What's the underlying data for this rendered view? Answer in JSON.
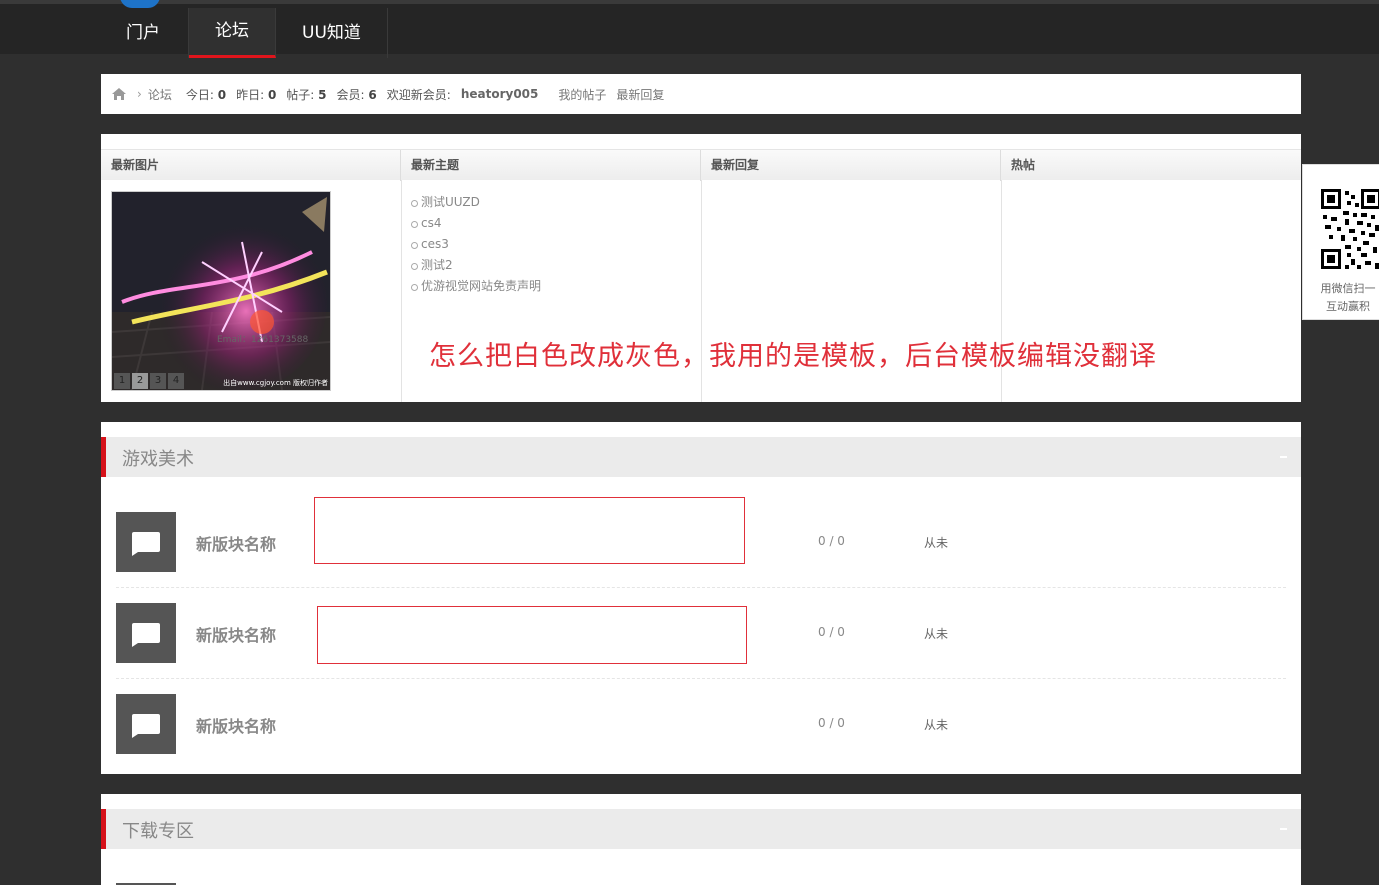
{
  "nav": {
    "items": [
      {
        "label": "门户",
        "active": false
      },
      {
        "label": "论坛",
        "active": true
      },
      {
        "label": "UU知道",
        "active": false
      }
    ]
  },
  "breadcrumb": {
    "home_icon": "home-icon",
    "separator": "›",
    "current": "论坛",
    "today_label": "今日:",
    "today_value": "0",
    "yesterday_label": "昨日:",
    "yesterday_value": "0",
    "posts_label": "帖子:",
    "posts_value": "5",
    "members_label": "会员:",
    "members_value": "6",
    "welcome_label": "欢迎新会员:",
    "welcome_user": "heatory005",
    "my_posts": "我的帖子",
    "latest_replies": "最新回复"
  },
  "portal": {
    "columns": [
      "最新图片",
      "最新主题",
      "最新回复",
      "热帖"
    ],
    "slideshow": {
      "pages": [
        "1",
        "2",
        "3",
        "4"
      ],
      "current_page": "2",
      "watermark": "Email：1261373588",
      "caption": "出自www.cgjoy.com 版权归作者"
    },
    "latest_topics": [
      "测试UUZD",
      "cs4",
      "ces3",
      "测试2",
      "优游视觉网站免责声明"
    ],
    "annotation": "怎么把白色改成灰色，我用的是模板，后台模板编辑没翻译"
  },
  "qr_widget": {
    "line1": "用微信扫一",
    "line2": "互动赢积"
  },
  "sections": [
    {
      "title": "游戏美术",
      "forums": [
        {
          "name": "新版块名称",
          "counts": "0 / 0",
          "last": "从未"
        },
        {
          "name": "新版块名称",
          "counts": "0 / 0",
          "last": "从未"
        },
        {
          "name": "新版块名称",
          "counts": "0 / 0",
          "last": "从未"
        }
      ]
    },
    {
      "title": "下载专区",
      "forums": []
    }
  ],
  "colors": {
    "accent": "#e0151c",
    "annotation": "#e0303a",
    "page_bg": "#2f2f2f",
    "nav_bg": "#252525"
  }
}
